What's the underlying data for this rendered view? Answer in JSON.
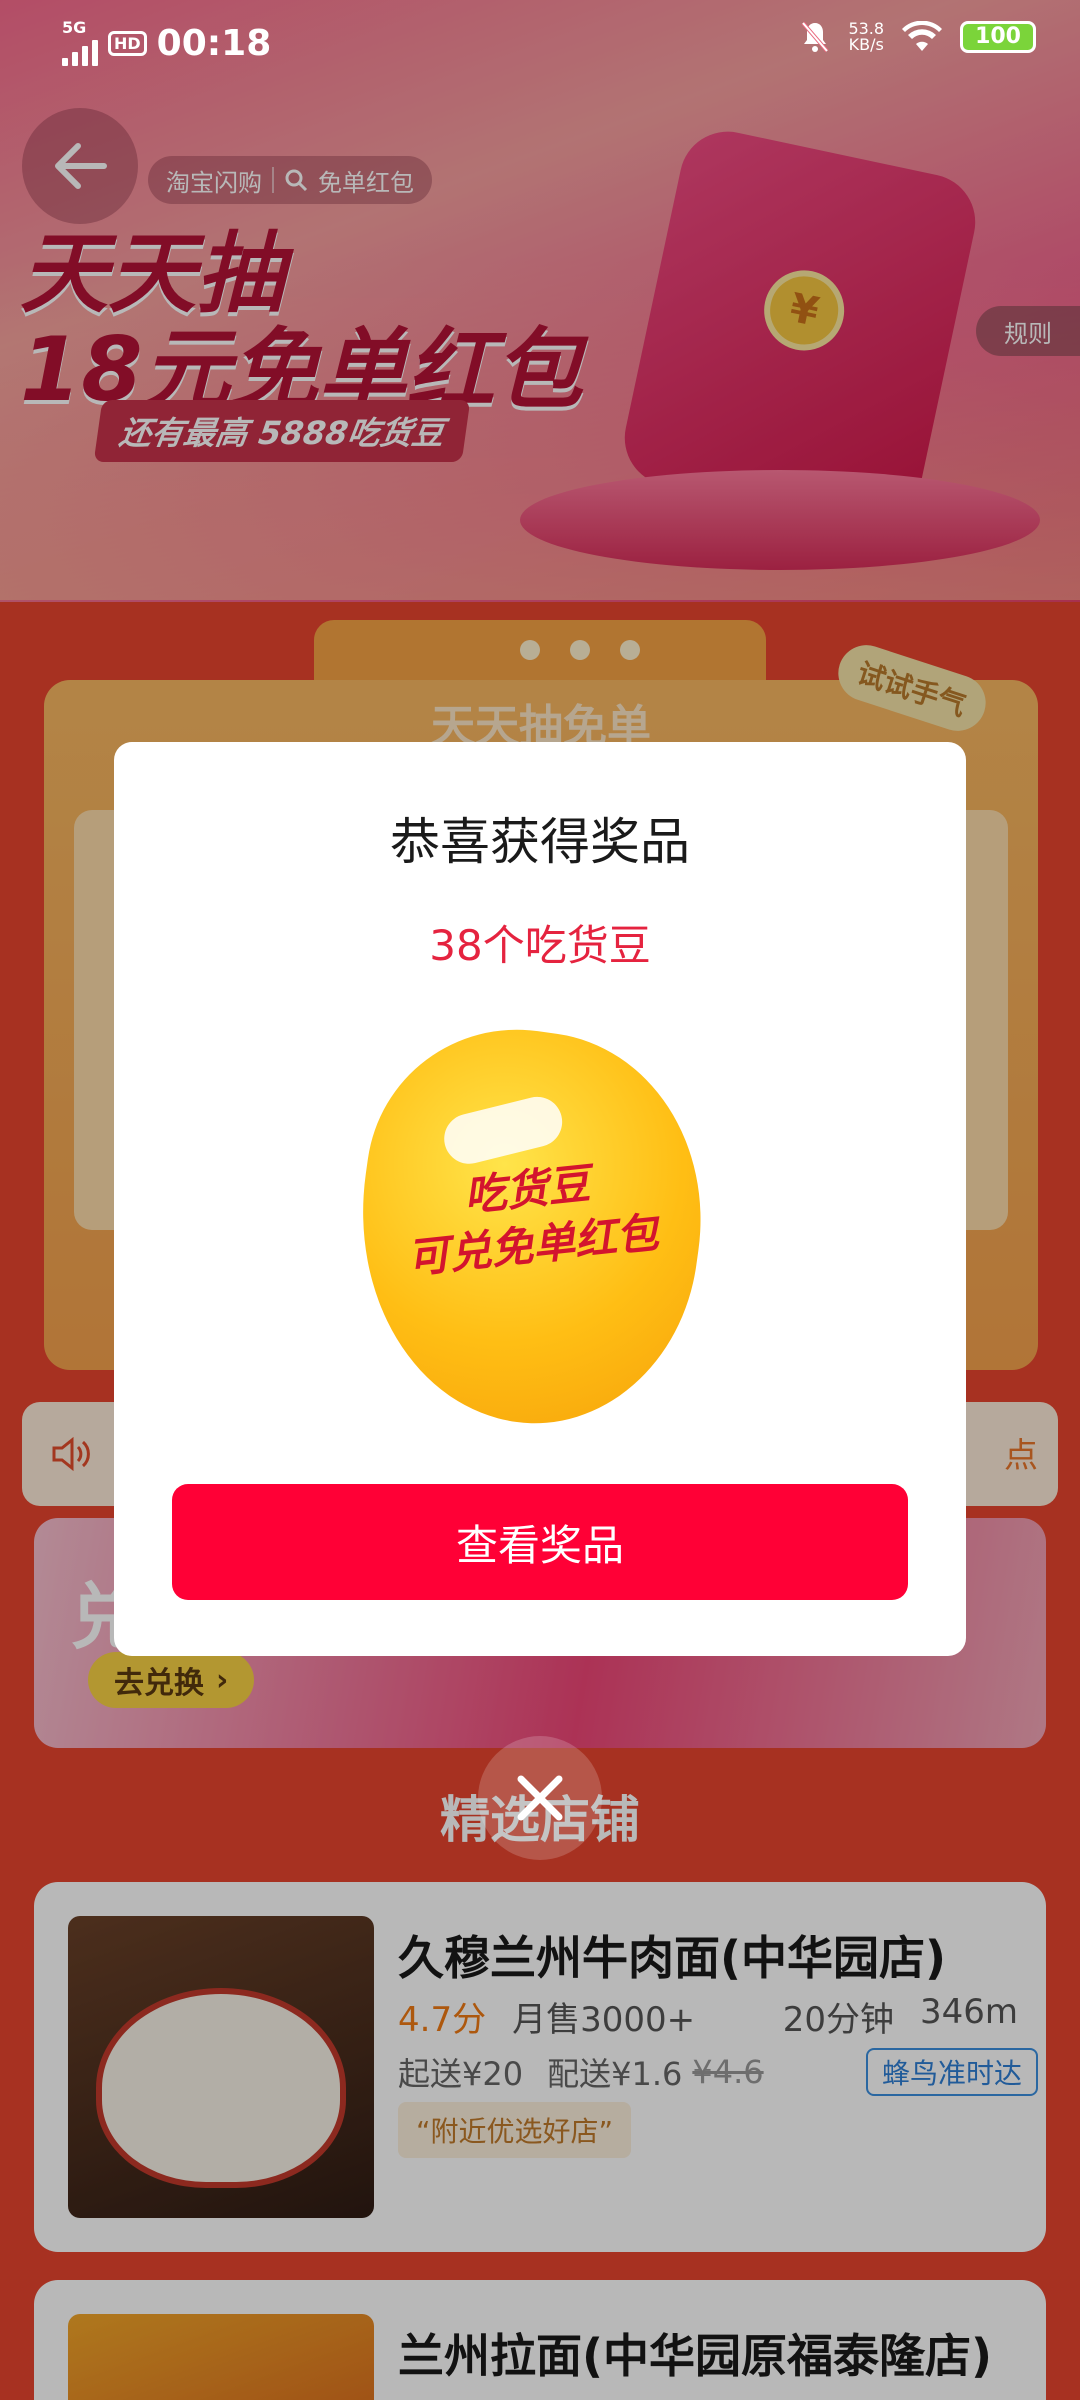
{
  "status_bar": {
    "network": "5G",
    "hd": "HD",
    "time": "00:18",
    "net_speed_value": "53.8",
    "net_speed_unit": "KB/s",
    "battery": "100",
    "icons": [
      "signal-icon",
      "mute-bell-icon",
      "wifi-icon",
      "battery-icon"
    ]
  },
  "banner": {
    "breadcrumb_app": "淘宝闪购",
    "breadcrumb_search": "免单红包",
    "headline_line1": "天天抽",
    "headline_line2": "18元免单红包",
    "subline": "还有最高 5888吃货豆",
    "rules": "规则"
  },
  "draw_card": {
    "title": "天天抽免单",
    "try_luck": "试试手气"
  },
  "notice": {
    "tail_text": "点"
  },
  "exchange": {
    "big_text": "兑",
    "button": "去兑换"
  },
  "section_title": "精选店铺",
  "shops": [
    {
      "name": "久穆兰州牛肉面(中华园店)",
      "rating": "4.7分",
      "monthly_sales": "月售3000+",
      "delivery_time": "20分钟",
      "distance": "346m",
      "min_order": "起送¥20",
      "delivery_fee": "配送¥1.6",
      "original_fee": "¥4.6",
      "delivery_tag": "蜂鸟准时达",
      "badge": "“附近优选好店”"
    },
    {
      "name": "兰州拉面(中华园原福泰隆店)"
    }
  ],
  "modal": {
    "title": "恭喜获得奖品",
    "prize": "38个吃货豆",
    "bean_line1": "吃货豆",
    "bean_line2": "可兑免单红包",
    "button": "查看奖品"
  },
  "colors": {
    "primary_red": "#ff0036",
    "prize_red": "#e5233f",
    "page_bg": "#e8452f"
  }
}
